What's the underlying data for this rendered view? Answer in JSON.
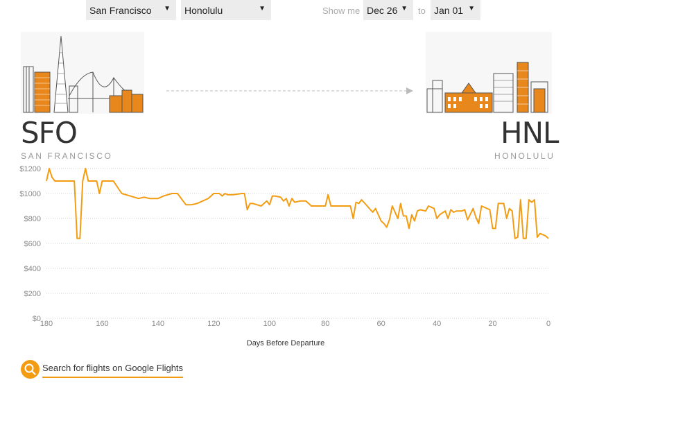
{
  "controls": {
    "origin": "San Francisco",
    "destination": "Honolulu",
    "show_me": "Show me",
    "from_date": "Dec 26",
    "to_word": "to",
    "to_date": "Jan 01"
  },
  "origin": {
    "code": "SFO",
    "name": "SAN FRANCISCO"
  },
  "destination": {
    "code": "HNL",
    "name": "HONOLULU"
  },
  "colors": {
    "accent": "#f39c12",
    "line": "#f39c12",
    "skyline_fill": "#e8871c"
  },
  "icons": {
    "dropdown": "caret-down-icon",
    "search": "magnifier-icon"
  },
  "search_link": "Search for flights on Google Flights",
  "chart_data": {
    "type": "line",
    "title": "",
    "xlabel": "Days Before Departure",
    "ylabel": "",
    "xlim": [
      180,
      0
    ],
    "ylim": [
      0,
      1200
    ],
    "x_ticks": [
      180,
      160,
      140,
      120,
      100,
      80,
      60,
      40,
      20,
      0
    ],
    "y_ticks": [
      0,
      200,
      400,
      600,
      800,
      1000,
      1200
    ],
    "y_tick_labels": [
      "$0",
      "$200",
      "$400",
      "$600",
      "$800",
      "$1000",
      "$1200"
    ],
    "grid": true,
    "series": [
      {
        "x": [
          180,
          179,
          178,
          177,
          175,
          170,
          169,
          168,
          167,
          166,
          165,
          162,
          161,
          160,
          156,
          153,
          150,
          147,
          145,
          143,
          140,
          138,
          135,
          133,
          130,
          128,
          126,
          123,
          122,
          120,
          118,
          117,
          116,
          115,
          113,
          110,
          109,
          108,
          107,
          106,
          103,
          102,
          101,
          100,
          99,
          98,
          96,
          95,
          94,
          93,
          92,
          91,
          89,
          88,
          87,
          85,
          81,
          80,
          79,
          78,
          76,
          75,
          74,
          71,
          70,
          69,
          68,
          67,
          65,
          63,
          62,
          60,
          59,
          58,
          57,
          56,
          54,
          53,
          52,
          51,
          50,
          49,
          48,
          47,
          46,
          44,
          43,
          42,
          41,
          40,
          39,
          37,
          36,
          35,
          34,
          33,
          32,
          31,
          30,
          29,
          27,
          26,
          25,
          24,
          22,
          21,
          20,
          19,
          18,
          16,
          15,
          14,
          13,
          12,
          11,
          10,
          9,
          8,
          7,
          6,
          5,
          4,
          3,
          2,
          1,
          0
        ],
        "y": [
          1100,
          1200,
          1130,
          1100,
          1100,
          1100,
          640,
          640,
          1100,
          1200,
          1100,
          1100,
          1000,
          1100,
          1100,
          1000,
          980,
          960,
          970,
          960,
          960,
          980,
          1000,
          1000,
          910,
          910,
          920,
          950,
          960,
          1000,
          1000,
          980,
          1000,
          990,
          990,
          1000,
          1000,
          870,
          920,
          920,
          900,
          920,
          940,
          910,
          980,
          980,
          970,
          940,
          960,
          900,
          960,
          930,
          940,
          940,
          940,
          900,
          900,
          900,
          990,
          900,
          900,
          900,
          900,
          900,
          800,
          930,
          920,
          950,
          900,
          850,
          880,
          780,
          760,
          730,
          790,
          900,
          800,
          920,
          820,
          820,
          720,
          830,
          780,
          860,
          870,
          860,
          900,
          890,
          880,
          800,
          830,
          860,
          800,
          870,
          850,
          860,
          860,
          860,
          870,
          790,
          880,
          810,
          760,
          900,
          880,
          870,
          720,
          720,
          920,
          920,
          800,
          880,
          860,
          640,
          650,
          950,
          640,
          640,
          950,
          930,
          950,
          650,
          680,
          670,
          660,
          640
        ]
      }
    ]
  }
}
